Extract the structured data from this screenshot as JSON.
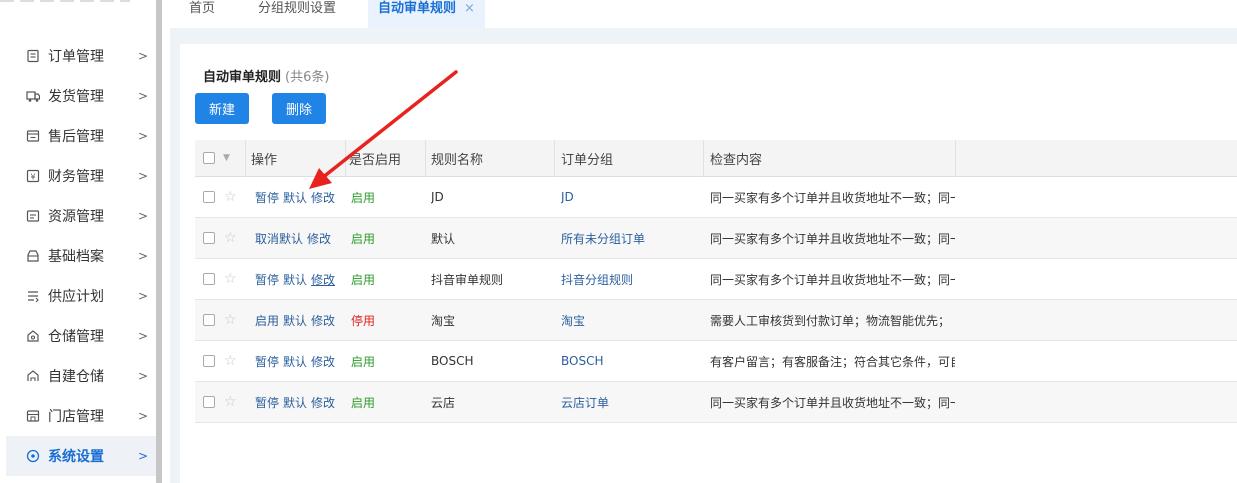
{
  "sidebar": {
    "items": [
      {
        "label": "订单管理",
        "icon": "order-icon"
      },
      {
        "label": "发货管理",
        "icon": "shipping-icon"
      },
      {
        "label": "售后管理",
        "icon": "aftersale-icon"
      },
      {
        "label": "财务管理",
        "icon": "finance-icon"
      },
      {
        "label": "资源管理",
        "icon": "resource-icon"
      },
      {
        "label": "基础档案",
        "icon": "archive-icon"
      },
      {
        "label": "供应计划",
        "icon": "supply-icon"
      },
      {
        "label": "仓储管理",
        "icon": "warehouse-icon"
      },
      {
        "label": "自建仓储",
        "icon": "self-warehouse-icon"
      },
      {
        "label": "门店管理",
        "icon": "store-icon"
      },
      {
        "label": "系统设置",
        "icon": "settings-icon",
        "active": true
      }
    ]
  },
  "tabs": [
    {
      "label": "首页"
    },
    {
      "label": "分组规则设置"
    },
    {
      "label": "自动审单规则",
      "active": true,
      "close": "×"
    }
  ],
  "page": {
    "title": "自动审单规则",
    "count": "(共6条)",
    "new_label": "新建",
    "delete_label": "删除"
  },
  "table": {
    "columns": [
      "操作",
      "是否启用",
      "规则名称",
      "订单分组",
      "检查内容"
    ],
    "rows": [
      {
        "actions": [
          "暂停",
          "默认",
          "修改"
        ],
        "status": "启用",
        "status_on": true,
        "name": "JD",
        "group": "JD",
        "content": "同一买家有多个订单并且收货地址不一致；同一"
      },
      {
        "actions": [
          "取消默认",
          "修改"
        ],
        "status": "启用",
        "status_on": true,
        "name": "默认",
        "group": "所有未分组订单",
        "content": "同一买家有多个订单并且收货地址不一致；同一"
      },
      {
        "actions": [
          "暂停",
          "默认",
          "修改"
        ],
        "status": "启用",
        "status_on": true,
        "name": "抖音审单规则",
        "group": "抖音分组规则",
        "content": "同一买家有多个订单并且收货地址不一致；同一",
        "underline_last": true
      },
      {
        "actions": [
          "启用",
          "默认",
          "修改"
        ],
        "status": "停用",
        "status_on": false,
        "name": "淘宝",
        "group": "淘宝",
        "content": "需要人工审核货到付款订单；物流智能优先；"
      },
      {
        "actions": [
          "暂停",
          "默认",
          "修改"
        ],
        "status": "启用",
        "status_on": true,
        "name": "BOSCH",
        "group": "BOSCH",
        "content": "有客户留言；有客服备注；符合其它条件，可自"
      },
      {
        "actions": [
          "暂停",
          "默认",
          "修改"
        ],
        "status": "启用",
        "status_on": true,
        "name": "云店",
        "group": "云店订单",
        "content": "同一买家有多个订单并且收货地址不一致；同一"
      }
    ]
  },
  "colors": {
    "accent": "#1f84e6",
    "link": "#2b5f9e",
    "enabled": "#2d9b2d",
    "disabled": "#e02020",
    "annotation_arrow": "#e8231f"
  }
}
